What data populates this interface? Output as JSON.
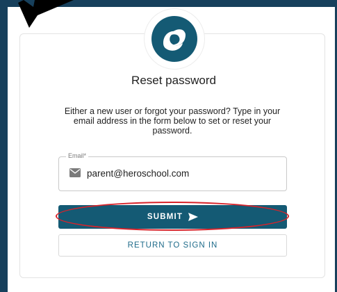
{
  "page": {
    "title": "Reset password",
    "description": "Either a new user or forgot your password? Type in your email address in the form below to set or reset your password."
  },
  "form": {
    "email_label": "Email*",
    "email_value": "parent@heroschool.com",
    "email_icon": "mail-icon"
  },
  "actions": {
    "submit_label": "SUBMIT",
    "submit_icon": "send-arrow-icon",
    "return_label": "RETURN TO SIGN IN"
  },
  "colors": {
    "frame_background": "#17405c",
    "accent": "#145a74",
    "link": "#1e6b8a",
    "highlight": "#d8232a"
  }
}
